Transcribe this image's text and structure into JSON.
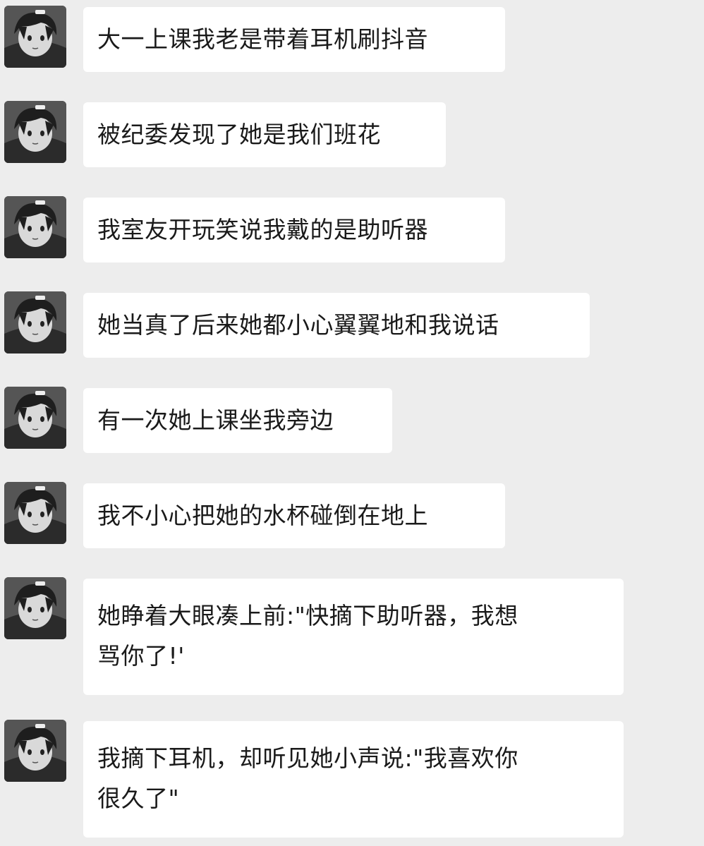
{
  "chat": {
    "messages": [
      {
        "lines": [
          "大一上课我老是带着耳机刷抖音"
        ]
      },
      {
        "lines": [
          "被纪委发现了她是我们班花"
        ]
      },
      {
        "lines": [
          "我室友开玩笑说我戴的是助听器"
        ]
      },
      {
        "lines": [
          "她当真了后来她都小心翼翼地和我说话"
        ]
      },
      {
        "lines": [
          "有一次她上课坐我旁边"
        ]
      },
      {
        "lines": [
          "我不小心把她的水杯碰倒在地上"
        ]
      },
      {
        "lines": [
          "她睁着大眼凑上前:\"快摘下助听器，我想",
          "骂你了!'"
        ]
      },
      {
        "lines": [
          "我摘下耳机，却听见她小声说:\"我喜欢你",
          "很久了\""
        ]
      }
    ]
  },
  "colors": {
    "background": "#ededed",
    "bubble": "#ffffff",
    "text": "#1a1a1a"
  }
}
